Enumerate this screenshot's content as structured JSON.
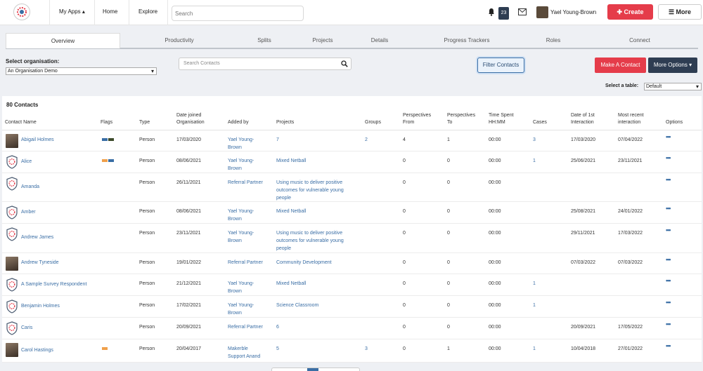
{
  "nav": {
    "my_apps": "My Apps ▴",
    "home": "Home",
    "explore": "Explore",
    "search_placeholder": "Search",
    "notifications": "23",
    "user_name": "Yael Young-Brown",
    "create": "Create",
    "more": "More"
  },
  "tabs": [
    "Overview",
    "Productivity",
    "Splits",
    "Projects",
    "Details",
    "Progress Trackers",
    "Roles",
    "Connect"
  ],
  "filters": {
    "org_label": "Select organisation:",
    "org_value": "An Organisation Demo",
    "contact_search_placeholder": "Search Contacts",
    "filter_contacts": "Filter Contacts",
    "make_contact": "Make A Contact",
    "more_options": "More Options ▾",
    "table_label": "Select a table:",
    "table_value": "Default"
  },
  "table": {
    "count": "80 Contacts",
    "headers": {
      "name": "Contact Name",
      "flags": "Flags",
      "type": "Type",
      "joined": "Date joined\nOrganisation",
      "added_by": "Added by",
      "projects": "Projects",
      "groups": "Groups",
      "persp_from": "Perspectives\nFrom",
      "persp_to": "Perspectives\nTo",
      "time": "Time Spent\nHH:MM",
      "cases": "Cases",
      "first": "Date of 1st\nInteraction",
      "recent": "Most recent\ninteraction",
      "options": "Options"
    },
    "rows": [
      {
        "name": "Abigail Holmes",
        "avatar": "photo",
        "flags": [
          "#3a6ea5",
          "#3d4b2b"
        ],
        "type": "Person",
        "joined": "17/03/2020",
        "added_by": "Yael Young-\nBrown",
        "projects": "7",
        "groups": "2",
        "from": "4",
        "to": "1",
        "time": "00:00",
        "cases": "3",
        "first": "17/03/2020",
        "recent": "07/04/2022"
      },
      {
        "name": "Alice",
        "avatar": "shield",
        "flags": [
          "#f0a04b",
          "#3a6ea5"
        ],
        "type": "Person",
        "joined": "08/06/2021",
        "added_by": "Yael Young-\nBrown",
        "projects": "Mixed Netball",
        "groups": "",
        "from": "0",
        "to": "0",
        "time": "00:00",
        "cases": "1",
        "first": "25/06/2021",
        "recent": "23/11/2021"
      },
      {
        "name": "Amanda",
        "avatar": "shield",
        "flags": [],
        "type": "Person",
        "joined": "26/11/2021",
        "added_by": "Referral Partner",
        "projects": "Using music to deliver positive\noutcomes for vulnerable young\npeople",
        "groups": "",
        "from": "0",
        "to": "0",
        "time": "00:00",
        "cases": "",
        "first": "",
        "recent": ""
      },
      {
        "name": "Amber",
        "avatar": "shield",
        "flags": [],
        "type": "Person",
        "joined": "08/06/2021",
        "added_by": "Yael Young-\nBrown",
        "projects": "Mixed Netball",
        "groups": "",
        "from": "0",
        "to": "0",
        "time": "00:00",
        "cases": "",
        "first": "25/08/2021",
        "recent": "24/01/2022"
      },
      {
        "name": "Andrew James",
        "avatar": "shield",
        "flags": [],
        "type": "Person",
        "joined": "23/11/2021",
        "added_by": "Yael Young-\nBrown",
        "projects": "Using music to deliver positive\noutcomes for vulnerable young\npeople",
        "groups": "",
        "from": "0",
        "to": "0",
        "time": "00:00",
        "cases": "",
        "first": "29/11/2021",
        "recent": "17/03/2022"
      },
      {
        "name": "Andrew Tyneside",
        "avatar": "photo",
        "flags": [],
        "type": "Person",
        "joined": "19/01/2022",
        "added_by": "Referral Partner",
        "projects": "Community Development",
        "groups": "",
        "from": "0",
        "to": "0",
        "time": "00:00",
        "cases": "",
        "first": "07/03/2022",
        "recent": "07/03/2022"
      },
      {
        "name": "A Sample Survey Respondent",
        "avatar": "shield",
        "flags": [],
        "type": "Person",
        "joined": "21/12/2021",
        "added_by": "Yael Young-\nBrown",
        "projects": "Mixed Netball",
        "groups": "",
        "from": "0",
        "to": "0",
        "time": "00:00",
        "cases": "1",
        "first": "",
        "recent": ""
      },
      {
        "name": "Benjamin Holmes",
        "avatar": "shield",
        "flags": [],
        "type": "Person",
        "joined": "17/02/2021",
        "added_by": "Yael Young-\nBrown",
        "projects": "Science Classroom",
        "groups": "",
        "from": "0",
        "to": "0",
        "time": "00:00",
        "cases": "1",
        "first": "",
        "recent": ""
      },
      {
        "name": "Caris",
        "avatar": "shield",
        "flags": [],
        "type": "Person",
        "joined": "20/09/2021",
        "added_by": "Referral Partner",
        "projects": "6",
        "groups": "",
        "from": "0",
        "to": "0",
        "time": "00:00",
        "cases": "",
        "first": "20/09/2021",
        "recent": "17/05/2022"
      },
      {
        "name": "Carol Hastings",
        "avatar": "photo",
        "flags": [
          "#f0a04b"
        ],
        "type": "Person",
        "joined": "20/04/2017",
        "added_by": "Makerble\nSupport Anand",
        "projects": "5",
        "groups": "3",
        "from": "0",
        "to": "1",
        "time": "00:00",
        "cases": "1",
        "first": "10/04/2018",
        "recent": "27/01/2022"
      }
    ]
  }
}
